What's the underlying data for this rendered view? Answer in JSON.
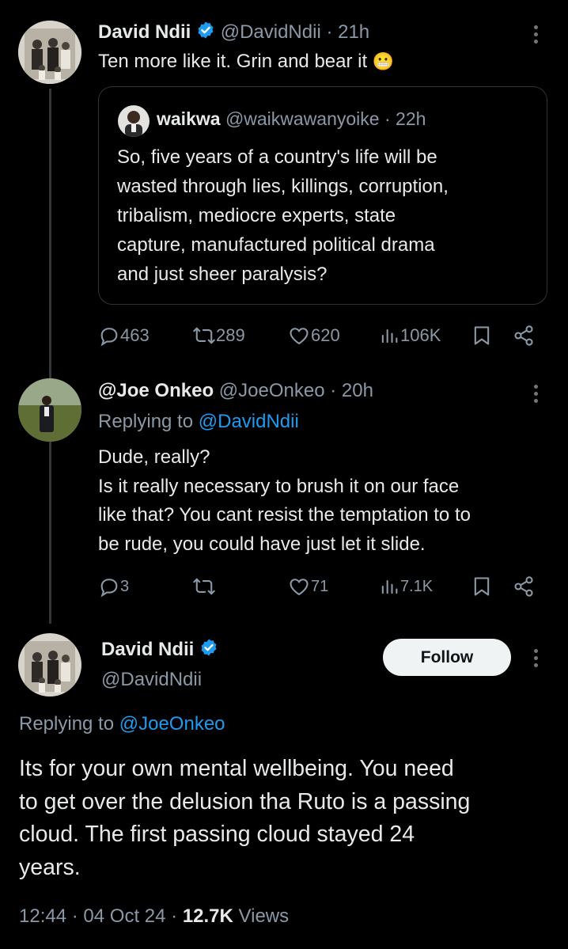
{
  "tweet1": {
    "name": "David Ndii",
    "handle": "@DavidNdii",
    "time": "· 21h",
    "text": "Ten more like it. Grin and bear it",
    "emoji": "😬",
    "quote": {
      "name": "waikwa",
      "handle": "@waikwawanyoike",
      "time": "· 22h",
      "lines": [
        "So, five years of a country's life will be",
        "wasted through lies, killings, corruption,",
        "tribalism, mediocre experts, state",
        "capture, manufactured political drama",
        "and just sheer paralysis?"
      ]
    },
    "replies": "463",
    "reposts": "289",
    "likes": "620",
    "views": "106K"
  },
  "tweet2": {
    "name": "@Joe Onkeo",
    "handle": "@JoeOnkeo",
    "time": "· 20h",
    "replying_prefix": "Replying to",
    "replying_to": "@DavidNdii",
    "lines": [
      "Dude, really?",
      "Is it really necessary to brush it on our face",
      "like that? You cant resist the temptation to to",
      "be rude, you could have just let it slide."
    ],
    "replies": "3",
    "reposts": "",
    "likes": "71",
    "views": "7.1K"
  },
  "tweet3": {
    "name": "David Ndii",
    "handle": "@DavidNdii",
    "follow_label": "Follow",
    "replying_prefix": "Replying to",
    "replying_to": "@JoeOnkeo",
    "lines": [
      "Its for your own mental wellbeing. You need",
      "to get over the delusion tha Ruto is a passing",
      "cloud. The first passing cloud stayed 24",
      "years."
    ],
    "time": "12:44",
    "date": "04 Oct 24",
    "views_count": "12.7K",
    "views_label": "Views",
    "sep": "·"
  },
  "colors": {
    "background": "#000000",
    "text": "#e7e9ea",
    "muted": "#8b98a5",
    "link": "#1d9bf0",
    "verified": "#1d9bf0"
  }
}
